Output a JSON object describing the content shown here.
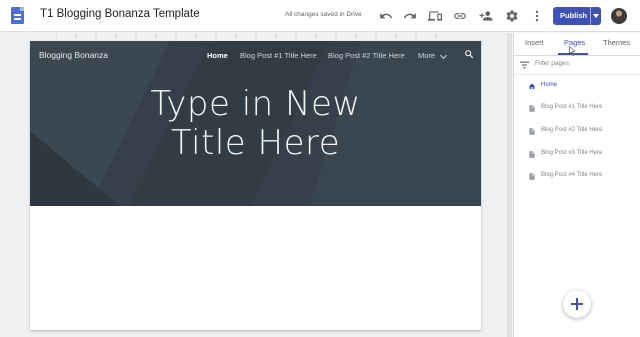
{
  "app": {
    "title": "T1 Blogging Bonanza Template",
    "save_status": "All changes saved in Drive"
  },
  "toolbar": {
    "icons": [
      "undo-icon",
      "redo-icon",
      "preview-icon",
      "link-icon",
      "share-icon",
      "settings-icon",
      "more-icon"
    ],
    "publish_label": "Publish"
  },
  "site": {
    "name": "Blogging Bonanza",
    "nav": [
      "Home",
      "Blog Post #1 Title Here",
      "Blog Post #2 Title Here",
      "More"
    ],
    "hero_title_line1": "Type in New",
    "hero_title_line2": "Title Here"
  },
  "panel": {
    "tabs": [
      "Insert",
      "Pages",
      "Themes"
    ],
    "active_tab": "Pages",
    "filter_placeholder": "Filter pages",
    "pages": [
      "Home",
      "Blog Post #1 Title Here",
      "Blog Post #2 Title Here",
      "Blog Post #3 Title Here",
      "Blog Post #4 Title Here"
    ]
  },
  "colors": {
    "accent": "#3f51b5",
    "hero_bg": "#35404a"
  }
}
